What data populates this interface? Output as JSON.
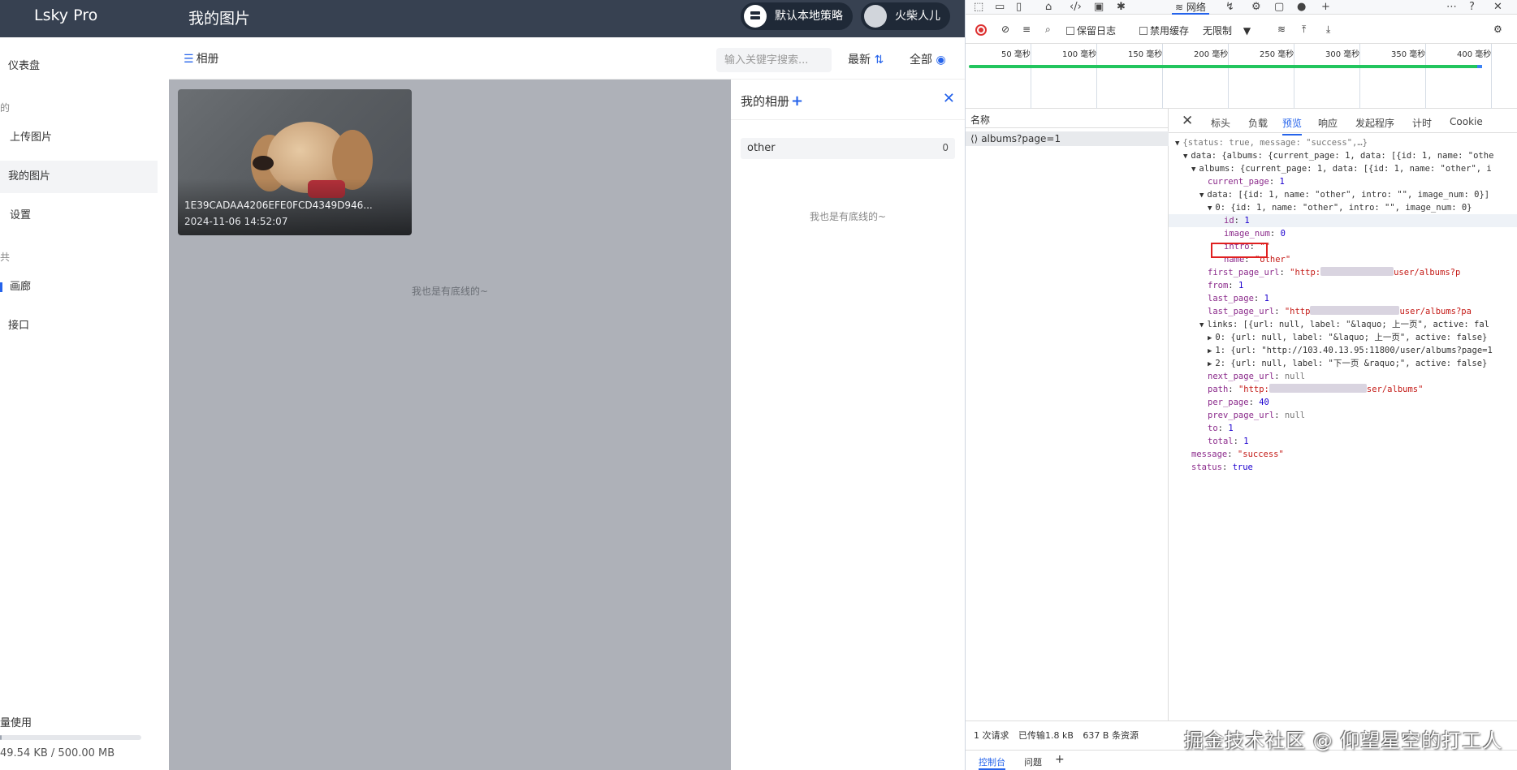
{
  "app": {
    "brand": "Lsky Pro",
    "page_title": "我的图片",
    "strategy_label": "默认本地策略",
    "user_name": "火柴人儿"
  },
  "sidebar": {
    "items": [
      {
        "label": "仪表盘"
      },
      {
        "label": "上传图片"
      },
      {
        "label": "我的图片"
      },
      {
        "label": "设置"
      },
      {
        "label": "画廊"
      },
      {
        "label": "接口"
      }
    ],
    "section_my": "的",
    "section_public": "共",
    "usage_label": "量使用",
    "usage_text": "49.54 KB / 500.00 MB",
    "usage_fraction": 0.0001
  },
  "toolbar": {
    "albums_label": "相册",
    "search_placeholder": "输入关键字搜索...",
    "sort_label": "最新",
    "filter_label": "全部"
  },
  "gallery": {
    "image_name": "1E39CADAA4206EFE0FCD4349D946...",
    "image_date": "2024-11-06 14:52:07",
    "end_text": "我也是有底线的~"
  },
  "album_panel": {
    "title": "我的相册",
    "album_name": "other",
    "album_count": "0",
    "end_text": "我也是有底线的~"
  },
  "devtools": {
    "network_tab": "网络",
    "preserve_log": "保留日志",
    "disable_cache": "禁用缓存",
    "throttle": "无限制",
    "timeline_labels": [
      "50 毫秒",
      "100 毫秒",
      "150 毫秒",
      "200 毫秒",
      "250 毫秒",
      "300 毫秒",
      "350 毫秒",
      "400 毫秒"
    ],
    "list_header": "名称",
    "request_name": "albums?page=1",
    "detail_tabs": [
      "标头",
      "负载",
      "预览",
      "响应",
      "发起程序",
      "计时",
      "Cookie"
    ],
    "status_requests": "1 次请求",
    "status_transferred": "已传输1.8 kB",
    "status_resources": "637 B 条资源",
    "bottom_console": "控制台",
    "bottom_issues": "问题"
  },
  "json_preview": {
    "l1": "{status: true, message: \"success\",…}",
    "l2": "data: {albums: {current_page: 1, data: [{id: 1, name: \"othe",
    "l3": "albums: {current_page: 1, data: [{id: 1, name: \"other\", i",
    "l4_k": "current_page",
    "l4_v": "1",
    "l5": "data: [{id: 1, name: \"other\", intro: \"\", image_num: 0}]",
    "l6": "0: {id: 1, name: \"other\", intro: \"\", image_num: 0}",
    "l7_k": "id",
    "l7_v": "1",
    "l8_k": "image_num",
    "l8_v": "0",
    "l9_k": "intro",
    "l9_v": "\"\"",
    "l10_k": "name",
    "l10_v": "\"other\"",
    "l11_k": "first_page_url",
    "l11_v1": "\"http:",
    "l11_v2": "user/albums?p",
    "l12_k": "from",
    "l12_v": "1",
    "l13_k": "last_page",
    "l13_v": "1",
    "l14_k": "last_page_url",
    "l14_v1": "\"http",
    "l14_v2": "user/albums?pa",
    "l15": "links: [{url: null, label: \"&laquo; 上一页\", active: fal",
    "l16": "0: {url: null, label: \"&laquo; 上一页\", active: false}",
    "l17": "1: {url: \"http://103.40.13.95:11800/user/albums?page=1",
    "l18": "2: {url: null, label: \"下一页 &raquo;\", active: false}",
    "l19_k": "next_page_url",
    "l19_v": "null",
    "l20_k": "path",
    "l20_v1": "\"http:",
    "l20_v2": "ser/albums\"",
    "l21_k": "per_page",
    "l21_v": "40",
    "l22_k": "prev_page_url",
    "l22_v": "null",
    "l23_k": "to",
    "l23_v": "1",
    "l24_k": "total",
    "l24_v": "1",
    "l25_k": "message",
    "l25_v": "\"success\"",
    "l26_k": "status",
    "l26_v": "true"
  },
  "watermark": "掘金技术社区 @ 仰望星空的打工人"
}
